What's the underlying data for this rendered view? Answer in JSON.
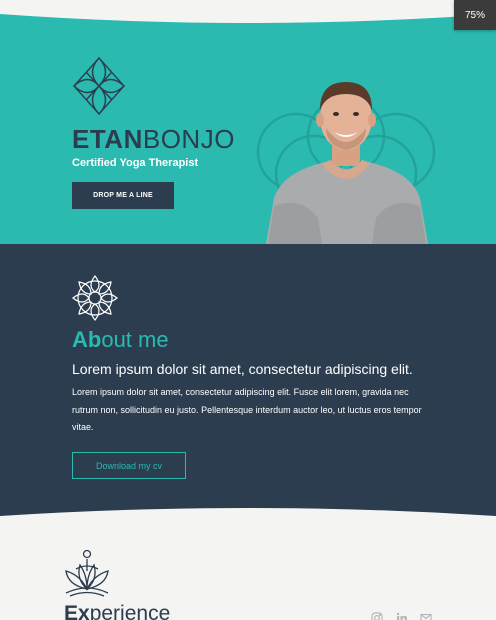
{
  "viewer": {
    "zoom_level": "75%"
  },
  "hero": {
    "name_bold": "ETAN",
    "name_light": "BONJO",
    "subtitle": "Certified Yoga Therapist",
    "cta_label": "DROP ME A LINE"
  },
  "about": {
    "title_bold": "Ab",
    "title_rest": "out me",
    "lead": "Lorem ipsum dolor sit amet, consectetur adipiscing elit.",
    "body": "Lorem ipsum dolor sit amet, consectetur adipiscing elit. Fusce elit lorem, gravida nec rutrum non, sollicitudin eu justo. Pellentesque interdum auctor leo, ut luctus eros tempor vitae.",
    "cv_label": "Download my cv"
  },
  "experience": {
    "title_bold": "Ex",
    "title_rest": "perience"
  },
  "social_icons": [
    "instagram-icon",
    "linkedin-icon",
    "email-icon"
  ],
  "colors": {
    "teal": "#2bbab0",
    "navy": "#2b3d4f",
    "background": "#f4f4f2"
  }
}
